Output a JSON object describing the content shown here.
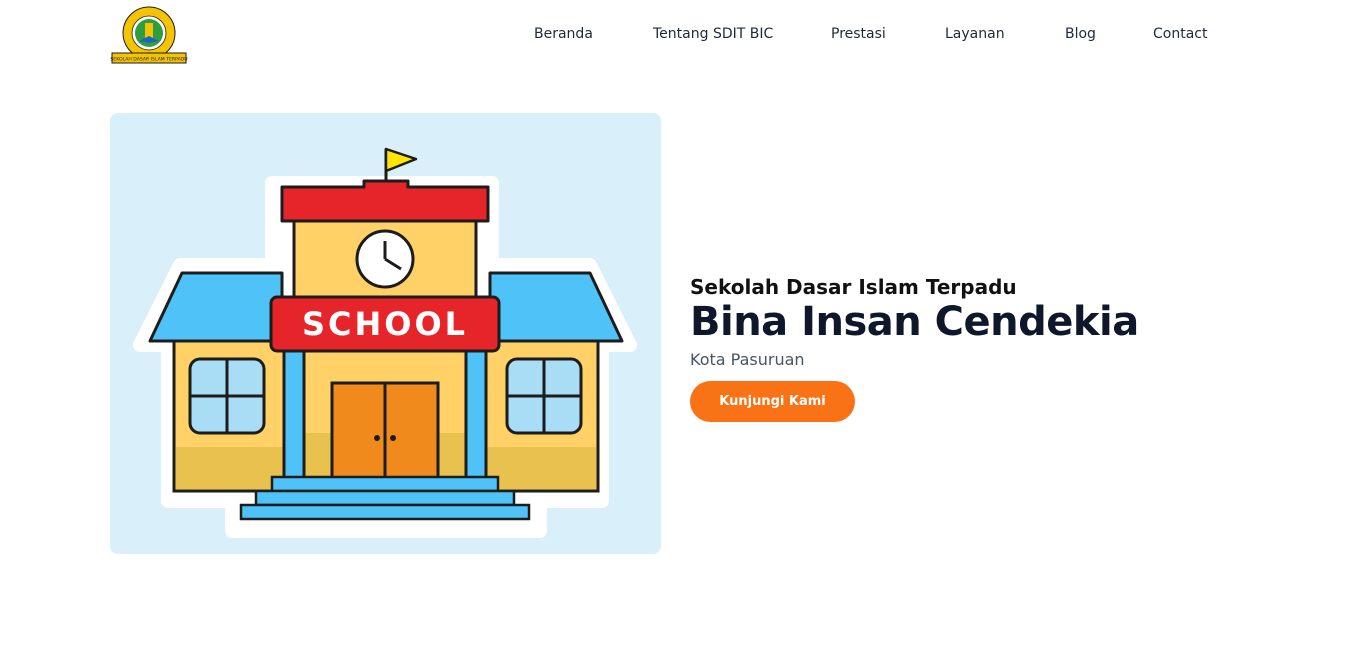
{
  "logo": {
    "ring_text": "BINA INSAN CENDEKIA",
    "banner_text": "SEKOLAH DASAR ISLAM TERPADU"
  },
  "nav": {
    "items": [
      {
        "label": "Beranda"
      },
      {
        "label": "Tentang SDIT BIC"
      },
      {
        "label": "Prestasi"
      },
      {
        "label": "Layanan"
      },
      {
        "label": "Blog"
      },
      {
        "label": "Contact"
      }
    ]
  },
  "hero": {
    "illustration_sign": "SCHOOL",
    "subtitle": "Sekolah Dasar Islam Terpadu",
    "title": "Bina Insan Cendekia",
    "city": "Kota Pasuruan",
    "cta_label": "Kunjungi Kami"
  },
  "colors": {
    "accent": "#f97316",
    "hero_bg": "#d9eff9",
    "title": "#0f172a"
  }
}
